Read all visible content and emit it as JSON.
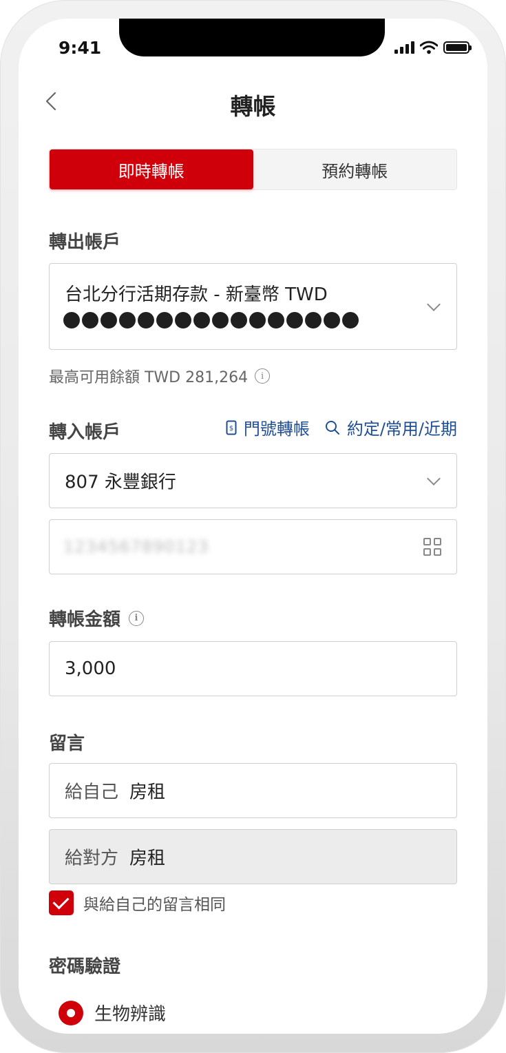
{
  "status_bar": {
    "time": "9:41"
  },
  "header": {
    "title": "轉帳",
    "back_icon": "chevron-left-icon"
  },
  "tabs": [
    {
      "label": "即時轉帳",
      "active": true
    },
    {
      "label": "預約轉帳",
      "active": false
    }
  ],
  "source": {
    "label": "轉出帳戶",
    "account_name": "台北分行活期存款 - 新臺幣 TWD",
    "masked_count": 16,
    "balance_hint": "最高可用餘額 TWD 281,264"
  },
  "destination": {
    "label": "轉入帳戶",
    "links": [
      {
        "label": "門號轉帳",
        "icon": "phone-dollar-icon"
      },
      {
        "label": "約定/常用/近期",
        "icon": "search-icon"
      }
    ],
    "bank": "807 永豐銀行",
    "account_placeholder": "1234567890123"
  },
  "amount": {
    "label": "轉帳金額",
    "value": "3,000"
  },
  "message": {
    "label": "留言",
    "self_prefix": "給自己",
    "self_value": "房租",
    "other_prefix": "給對方",
    "other_value": "房租",
    "same_checkbox_label": "與給自己的留言相同",
    "same_checked": true
  },
  "auth": {
    "label": "密碼驗證",
    "option": "生物辨識",
    "selected": true
  },
  "colors": {
    "accent": "#d0000a",
    "link": "#1f4e96"
  }
}
